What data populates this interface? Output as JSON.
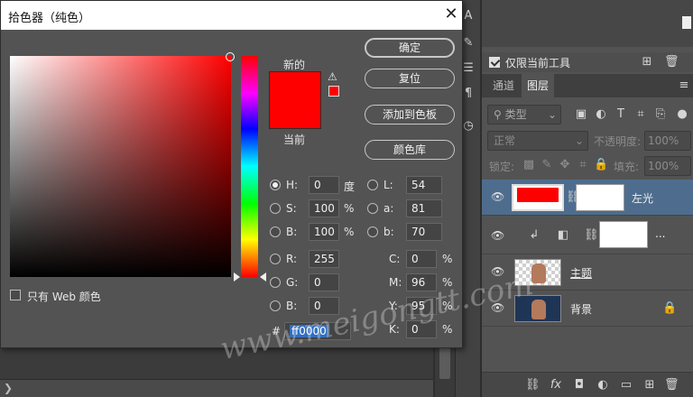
{
  "dialog": {
    "title": "拾色器（纯色）",
    "close": "✕",
    "new_label": "新的",
    "current_label": "当前",
    "new_color": "#ff0000",
    "current_color": "#ff0000",
    "buttons": {
      "ok": "确定",
      "reset": "复位",
      "add_swatch": "添加到色板",
      "color_library": "颜色库"
    },
    "fields": {
      "H": {
        "label": "H:",
        "value": "0",
        "unit": "度"
      },
      "S": {
        "label": "S:",
        "value": "100",
        "unit": "%"
      },
      "Bh": {
        "label": "B:",
        "value": "100",
        "unit": "%"
      },
      "R": {
        "label": "R:",
        "value": "255"
      },
      "G": {
        "label": "G:",
        "value": "0"
      },
      "Bb": {
        "label": "B:",
        "value": "0"
      },
      "L": {
        "label": "L:",
        "value": "54"
      },
      "a": {
        "label": "a:",
        "value": "81"
      },
      "b": {
        "label": "b:",
        "value": "70"
      },
      "C": {
        "label": "C:",
        "value": "0",
        "unit": "%"
      },
      "M": {
        "label": "M:",
        "value": "96",
        "unit": "%"
      },
      "Y": {
        "label": "Y:",
        "value": "95",
        "unit": "%"
      },
      "K": {
        "label": "K:",
        "value": "0",
        "unit": "%"
      }
    },
    "hex_label": "#",
    "hex_value": "ff0000",
    "web_only_label": "只有 Web 颜色"
  },
  "layers_panel": {
    "only_current_tool": "仅限当前工具",
    "tabs": [
      "通道",
      "图层"
    ],
    "active_tab": "图层",
    "kind_filter": "类型",
    "blend_mode": "正常",
    "opacity_label": "不透明度:",
    "opacity_value": "100%",
    "lock_label": "锁定:",
    "fill_label": "填充:",
    "fill_value": "100%",
    "layers": [
      {
        "name": "左光",
        "selected": true
      },
      {
        "name": "...",
        "selected": false
      },
      {
        "name": "主题",
        "selected": false
      },
      {
        "name": "背景",
        "selected": false
      }
    ]
  },
  "watermark": "www.meigongtt.com",
  "colors": {
    "accent": "#4e6d8e",
    "hex_highlight": "#2f6fc2",
    "panel_bg": "#535353"
  }
}
